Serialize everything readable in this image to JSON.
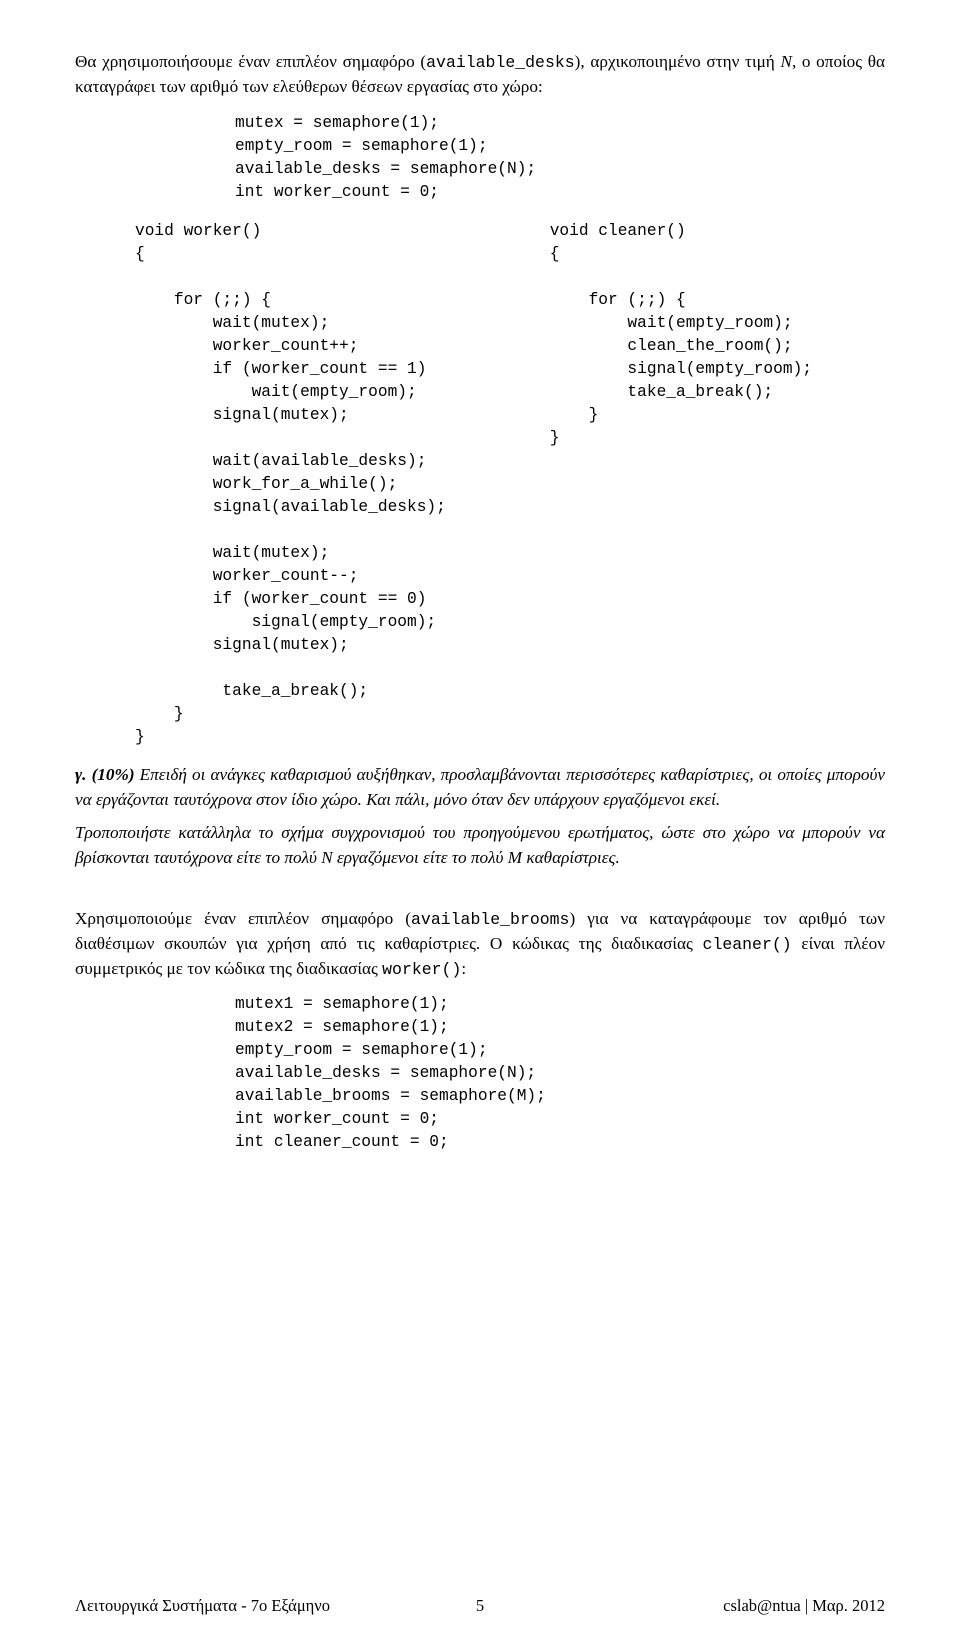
{
  "intro_p1_a": "Θα χρησιμοποιήσουμε έναν επιπλέον σημαφόρο (",
  "intro_p1_code": "available_desks",
  "intro_p1_b": "), αρχικοποιημένο στην τιμή ",
  "intro_p1_var": "N",
  "intro_p1_c": ", ο οποίος θα καταγράφει των αριθμό των ελεύθερων θέσεων εργασίας στο χώρο:",
  "init_block1": "mutex = semaphore(1);\nempty_room = semaphore(1);\navailable_desks = semaphore(N);\nint worker_count = 0;",
  "worker_code": "void worker()\n{\n\n    for (;;) {\n        wait(mutex);\n        worker_count++;\n        if (worker_count == 1)\n            wait(empty_room);\n        signal(mutex);\n\n        wait(available_desks);\n        work_for_a_while();\n        signal(available_desks);\n\n        wait(mutex);\n        worker_count--;\n        if (worker_count == 0)\n            signal(empty_room);\n        signal(mutex);\n\n         take_a_break();\n    }\n}",
  "cleaner_code": "void cleaner()\n{\n\n    for (;;) {\n        wait(empty_room);\n        clean_the_room();\n        signal(empty_room);\n        take_a_break();\n    }\n}",
  "q_label": "γ. (10%)",
  "q_text_a": "   Επειδή οι ανάγκες καθαρισμού αυξήθηκαν, προσλαμβάνονται περισσότερες καθαρίστριες, οι οποίες μπορούν να εργάζονται ταυτόχρονα στον ίδιο χώρο. Και πάλι, μόνο όταν δεν υπάρχουν εργαζόμενοι εκεί.",
  "q_text_b_a": "Τροποποιήστε κατάλληλα το σχήμα συγχρονισμού του προηγούμενου ερωτήματος, ώστε στο χώρο να μπορούν να βρίσκονται ταυτόχρονα είτε το πολύ ",
  "q_var_N": "N",
  "q_text_b_b": " εργαζόμενοι είτε το πολύ ",
  "q_var_M": "M",
  "q_text_b_c": " καθαρίστριες.",
  "mid_p_a": "Χρησιμοποιούμε έναν επιπλέον σημαφόρο (",
  "mid_code1": "available_brooms",
  "mid_p_b": ") για να καταγράφουμε τον αριθμό των διαθέσιμων σκουπών για χρήση από τις καθαρίστριες. Ο κώδικας της διαδικασίας ",
  "mid_code2": "cleaner()",
  "mid_p_c": " είναι πλέον συμμετρικός με τον κώδικα της διαδικασίας ",
  "mid_code3": "worker()",
  "mid_p_d": ":",
  "init_block2": "mutex1 = semaphore(1);\nmutex2 = semaphore(1);\nempty_room = semaphore(1);\navailable_desks = semaphore(N);\navailable_brooms = semaphore(M);\nint worker_count = 0;\nint cleaner_count = 0;",
  "footer_left": "Λειτουργικά Συστήματα - 7ο Εξάμηνο",
  "footer_center": "5",
  "footer_right": "cslab@ntua | Μαρ. 2012"
}
